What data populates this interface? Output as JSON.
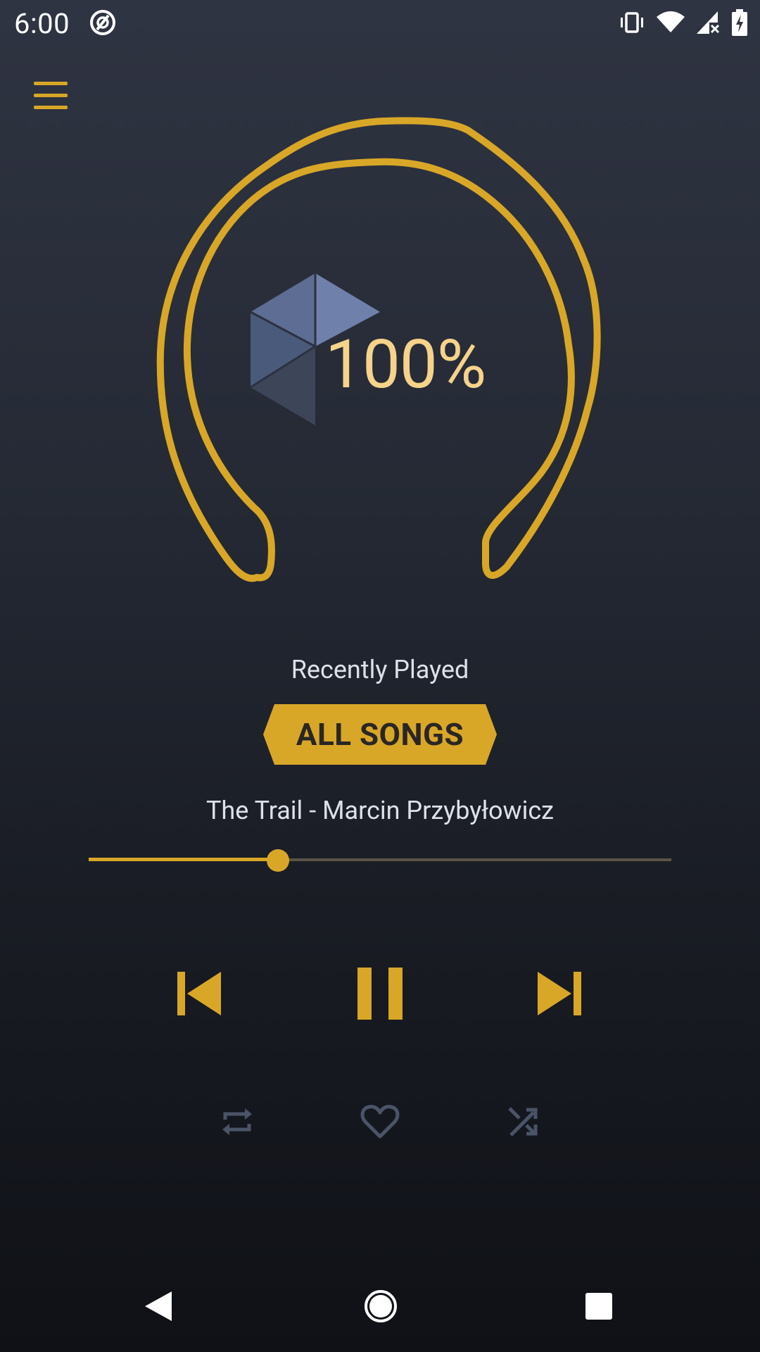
{
  "status_bar": {
    "time": "6:00",
    "icons": [
      "app-notification-icon",
      "vibrate-icon",
      "wifi-icon",
      "cellular-no-signal-icon",
      "battery-charging-icon"
    ]
  },
  "header": {
    "menu_icon": "hamburger-menu-icon"
  },
  "device": {
    "battery_percent": "100%",
    "image": "headphone-ring-outline"
  },
  "player": {
    "section_label": "Recently Played",
    "playlist_button_label": "ALL SONGS",
    "track_title": "The Trail - Marcin Przybyłowicz",
    "progress_fraction": 0.325,
    "controls": [
      "previous-icon",
      "pause-icon",
      "next-icon"
    ],
    "secondary_controls": [
      "repeat-icon",
      "heart-icon",
      "shuffle-icon"
    ]
  },
  "navigation_bar": [
    "back-icon",
    "home-icon",
    "recents-icon"
  ],
  "colors": {
    "accent": "#d9a727",
    "percent_text": "#f6d38a",
    "muted_icon": "#4a5468",
    "background_top": "#2f3442",
    "background_bottom": "#0f1116"
  }
}
